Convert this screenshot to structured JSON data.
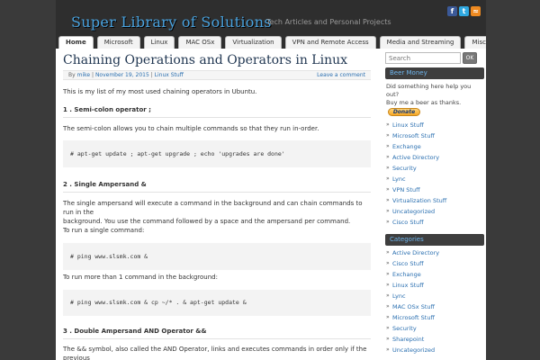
{
  "header": {
    "site_title": "Super Library of Solutions",
    "site_description": "Tech Articles and Personal Projects",
    "social": [
      "facebook-icon",
      "twitter-icon",
      "rss-icon"
    ]
  },
  "nav": {
    "tabs": [
      "Home",
      "Microsoft",
      "Linux",
      "MAC OSx",
      "Virtualization",
      "VPN and Remote Access",
      "Media and Streaming",
      "Misc Tech Notes"
    ]
  },
  "post": {
    "title": "Chaining Operations and Operators in Linux",
    "meta": {
      "by": "By",
      "author": "mike",
      "date": "November 19, 2015",
      "category": "Linux Stuff",
      "leave_comment": "Leave a comment"
    },
    "intro": "This is my list of my most used chaining operators in Ubuntu.",
    "s1_heading": "1 .   Semi-colon operator ;",
    "s1_text": "The semi-colon allows you to chain multiple commands so that they run in-order.",
    "s1_code": "# apt-get update ; apt-get upgrade ; echo 'upgrades are done'",
    "s2_heading": "2 . Single Ampersand &",
    "s2_text1": "The single ampersand will execute a command in the background and can chain commands to run in the",
    "s2_text2": "background. You use the command followed by a space and the ampersand per command.",
    "s2_text3": "To run a single command:",
    "s2_code1": "# ping www.slsmk.com &",
    "s2_text4": "To run more than 1 command in the background:",
    "s2_code2": "# ping www.slsmk.com & cp ~/* . & apt-get update &",
    "s3_heading": "3 . Double Ampersand AND Operator &&",
    "s3_text": "The && symbol, also called the AND Operator, links and executes commands in order only if the previous"
  },
  "sidebar": {
    "search_placeholder": "Search",
    "search_button": "OK",
    "beer_title": "Beer Money",
    "beer_text1": "Did something here help you out?",
    "beer_text2": "Buy me a beer as thanks.",
    "donate_label": "Donate",
    "links": [
      "Linux Stuff",
      "Microsoft Stuff",
      "Exchange",
      "Active Directory",
      "Security",
      "Lync",
      "VPN Stuff",
      "Virtualization Stuff",
      "Uncategorized",
      "Cisco Stuff"
    ],
    "categories_title": "Categories",
    "categories": [
      "Active Directory",
      "Cisco Stuff",
      "Exchange",
      "Linux Stuff",
      "Lync",
      "MAC OSx Stuff",
      "Microsoft Stuff",
      "Security",
      "Sharepoint",
      "Uncategorized"
    ]
  }
}
